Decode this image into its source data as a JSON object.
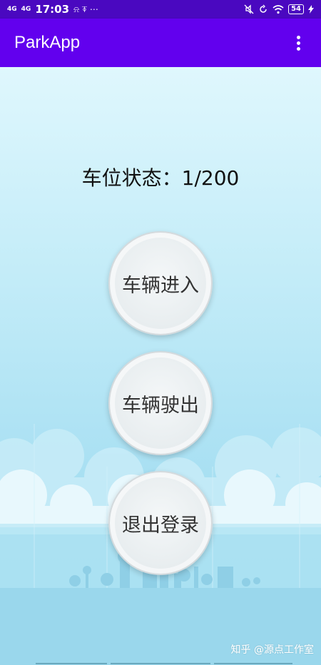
{
  "statusbar": {
    "signal1": "4G",
    "signal2": "4G",
    "time": "17:03",
    "icons_left": "⍾ ⍕ ⋯",
    "battery": "54"
  },
  "appbar": {
    "title": "ParkApp",
    "overflow_icon": "more-vert-icon"
  },
  "main": {
    "status_text": "车位状态：1/200",
    "buttons": {
      "enter": "车辆进入",
      "exit": "车辆驶出",
      "logout": "退出登录"
    }
  },
  "watermark": "知乎 @源点工作室",
  "colors": {
    "statusbar": "#4a08c0",
    "appbar": "#6200ee",
    "background_top": "#dff7fd",
    "background_bottom": "#9ad8ee"
  }
}
